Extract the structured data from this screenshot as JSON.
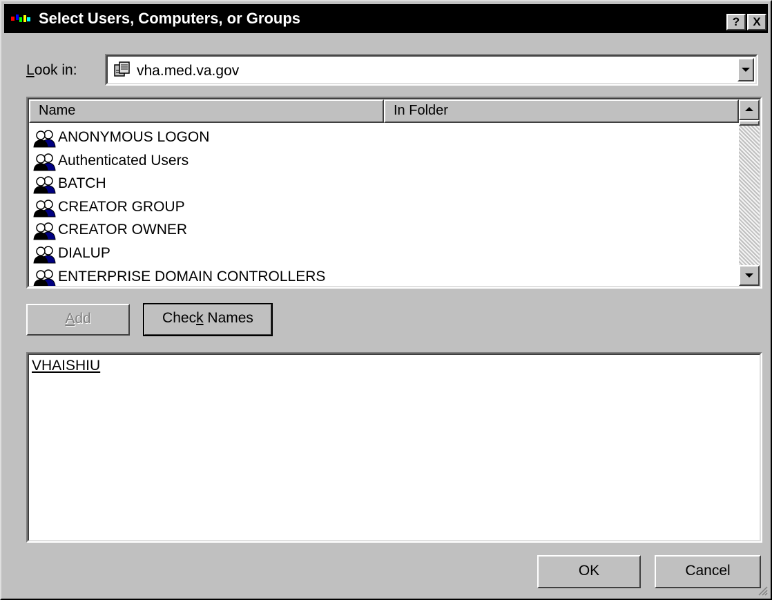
{
  "window": {
    "title": "Select Users, Computers, or Groups",
    "help_label": "?",
    "close_label": "X"
  },
  "lookin": {
    "label_prefix": "",
    "label_hotkey": "L",
    "label_suffix": "ook in:",
    "value": "vha.med.va.gov"
  },
  "list": {
    "columns": [
      "Name",
      "In Folder"
    ],
    "items": [
      "ANONYMOUS LOGON",
      "Authenticated Users",
      "BATCH",
      "CREATOR GROUP",
      "CREATOR OWNER",
      "DIALUP",
      "ENTERPRISE DOMAIN CONTROLLERS"
    ]
  },
  "buttons": {
    "add_hotkey": "A",
    "add_rest": "dd",
    "check_prefix": "Chec",
    "check_hotkey": "k",
    "check_suffix": " Names",
    "ok": "OK",
    "cancel": "Cancel"
  },
  "selected_names": "VHAISHIU",
  "colors": {
    "titlebar": "#000000",
    "dialog_bg": "#c0c0c0",
    "field_bg": "#ffffff",
    "disabled_text": "#808080"
  },
  "icons": {
    "app": "app-icon",
    "domain": "domain-icon",
    "group": "group-icon"
  }
}
